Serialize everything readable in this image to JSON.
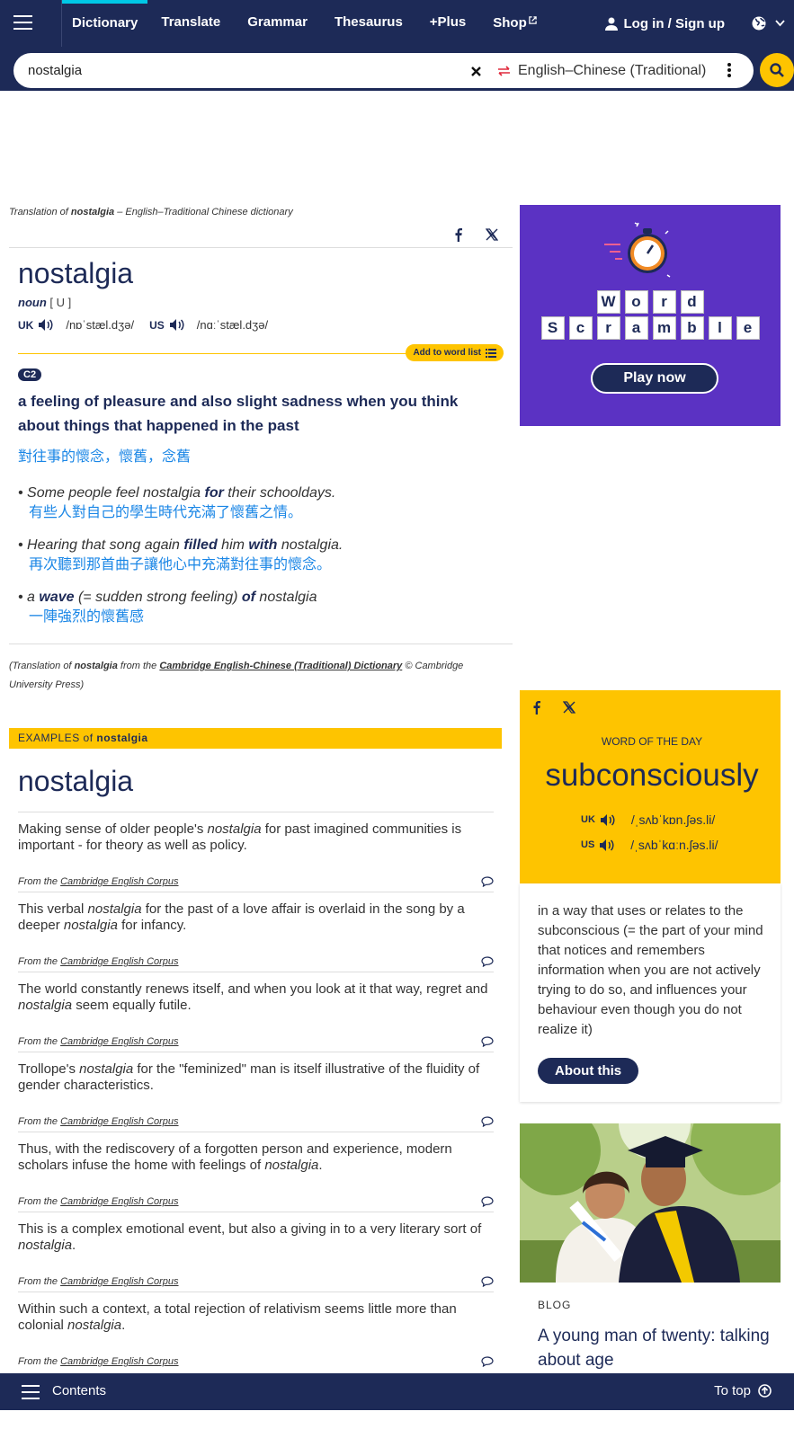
{
  "nav": {
    "links": [
      "Dictionary",
      "Translate",
      "Grammar",
      "Thesaurus",
      "+Plus",
      "Shop"
    ],
    "login": "Log in / Sign up"
  },
  "search": {
    "value": "nostalgia",
    "dictionary": "English–Chinese (Traditional)"
  },
  "entry": {
    "translation_of": {
      "pre": "Translation of ",
      "word": "nostalgia",
      "post": " – English–Traditional Chinese dictionary"
    },
    "headword": "nostalgia",
    "pos": "noun",
    "grammar": "[ U ]",
    "uk_label": "UK",
    "uk_ipa": "/nɒˈstæl.dʒə/",
    "us_label": "US",
    "us_ipa": "/nɑːˈstæl.dʒə/",
    "add_to_word_list": "Add to word list",
    "level": "C2",
    "definition": "a feeling of pleasure and also slight sadness when you think about things that happened in the past",
    "definition_translation": "對往事的懷念，懷舊，念舊",
    "examples": [
      {
        "parts": [
          [
            "Some people feel nostalgia ",
            false
          ],
          [
            "for",
            true
          ],
          [
            " their schooldays.",
            false
          ]
        ],
        "zh": "有些人對自己的學生時代充滿了懷舊之情。"
      },
      {
        "parts": [
          [
            "Hearing that song again ",
            false
          ],
          [
            "filled",
            true
          ],
          [
            " him ",
            false
          ],
          [
            "with",
            true
          ],
          [
            " nostalgia.",
            false
          ]
        ],
        "zh": "再次聽到那首曲子讓他心中充滿對往事的懷念。"
      },
      {
        "parts": [
          [
            "a ",
            false
          ],
          [
            "wave",
            true
          ],
          [
            " (= sudden strong feeling) ",
            false
          ],
          [
            "of",
            true
          ],
          [
            " nostalgia",
            false
          ]
        ],
        "zh": "一陣強烈的懷舊感"
      }
    ],
    "credit": {
      "pre": "(Translation of ",
      "word": "nostalgia",
      "mid": " from the ",
      "link": "Cambridge English-Chinese (Traditional) Dictionary",
      "post": " © Cambridge University Press)"
    }
  },
  "examples_section": {
    "bar_prefix": "EXAMPLES of ",
    "bar_word": "nostalgia",
    "title": "nostalgia",
    "from": "From the ",
    "source": "Cambridge English Corpus",
    "items": [
      [
        [
          "Making sense of older people's ",
          false
        ],
        [
          "nostalgia",
          true
        ],
        [
          " for past imagined communities is important - for theory as well as policy.",
          false
        ]
      ],
      [
        [
          "This verbal ",
          false
        ],
        [
          "nostalgia",
          true
        ],
        [
          " for the past of a love affair is overlaid in the song by a deeper ",
          false
        ],
        [
          "nostalgia",
          true
        ],
        [
          " for infancy.",
          false
        ]
      ],
      [
        [
          "The world constantly renews itself, and when you look at it that way, regret and ",
          false
        ],
        [
          "nostalgia",
          true
        ],
        [
          " seem equally futile.",
          false
        ]
      ],
      [
        [
          "Trollope's ",
          false
        ],
        [
          "nostalgia",
          true
        ],
        [
          " for the \"feminized\" man is itself illustrative of the fluidity of gender characteristics.",
          false
        ]
      ],
      [
        [
          "Thus, with the rediscovery of a forgotten person and experience, modern scholars infuse the home with feelings of ",
          false
        ],
        [
          "nostalgia",
          true
        ],
        [
          ".",
          false
        ]
      ],
      [
        [
          "This is a complex emotional event, but also a giving in to a very literary sort of ",
          false
        ],
        [
          "nostalgia",
          true
        ],
        [
          ".",
          false
        ]
      ],
      [
        [
          "Within such a context, a total rejection of relativism seems little more than colonial ",
          false
        ],
        [
          "nostalgia",
          true
        ],
        [
          ".",
          false
        ]
      ]
    ]
  },
  "ad": {
    "word1": [
      "W",
      "o",
      "r",
      "d"
    ],
    "word2": [
      "S",
      "c",
      "r",
      "a",
      "m",
      "b",
      "l",
      "e"
    ],
    "cta": "Play now",
    "bg": "#5b32c3"
  },
  "wotd": {
    "label": "WORD OF THE DAY",
    "word": "subconsciously",
    "uk_label": "UK",
    "uk_ipa": "/ˌsʌbˈkɒn.ʃəs.li/",
    "us_label": "US",
    "us_ipa": "/ˌsʌbˈkɑːn.ʃəs.li/",
    "definition": "in a way that uses or relates to the subconscious (= the part of your mind that notices and remembers information when you are not actively trying to do so, and influences your behaviour even though you do not realize it)",
    "button": "About this"
  },
  "blog": {
    "label": "BLOG",
    "title": "A young man of twenty: talking about age"
  },
  "bottom": {
    "contents": "Contents",
    "to_top": "To top"
  },
  "colors": {
    "navy": "#1d2a57",
    "yellow": "#fec400",
    "link_blue": "#1a86e6"
  }
}
